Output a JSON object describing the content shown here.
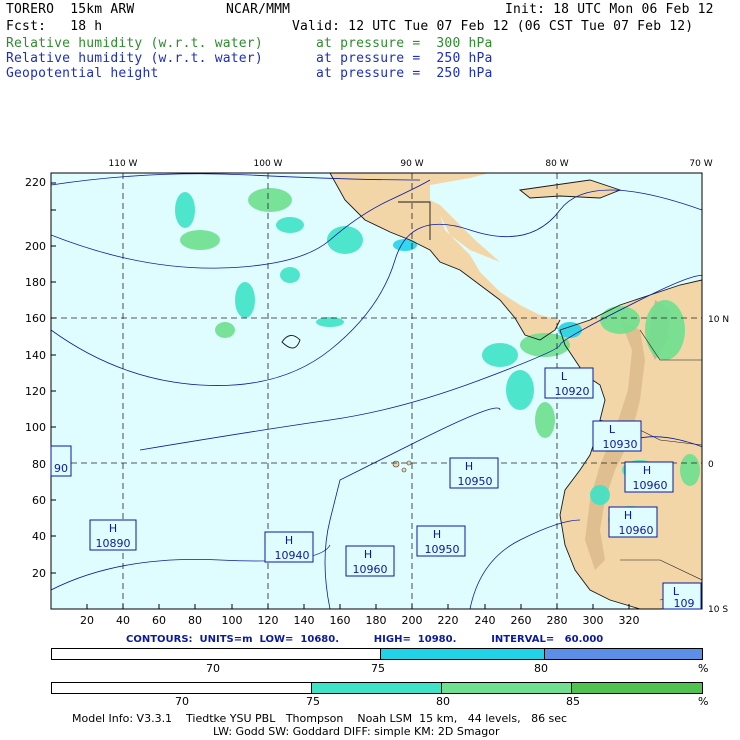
{
  "header": {
    "model": "TORERO  15km ARW",
    "center": "NCAR/MMM",
    "init": "Init: 18 UTC Mon 06 Feb 12",
    "fcst": "Fcst:   18 h",
    "valid": "Valid: 12 UTC Tue 07 Feb 12 (06 CST Tue 07 Feb 12)",
    "fields": [
      {
        "name": "Relative humidity (w.r.t. water)",
        "level": "at pressure =  300 hPa",
        "color": "#2e8b2e"
      },
      {
        "name": "Relative humidity (w.r.t. water)",
        "level": "at pressure =  250 hPa",
        "color": "#1c2fbf"
      },
      {
        "name": "Geopotential height",
        "level": "at pressure =  250 hPa",
        "color": "#1c2fbf"
      }
    ]
  },
  "map": {
    "lon_labels": [
      "110 W",
      "100 W",
      "90 W",
      "80 W",
      "70 W"
    ],
    "lat_labels": [
      "10 N",
      "0",
      "10 S"
    ],
    "x_ticks": [
      "20",
      "40",
      "60",
      "80",
      "100",
      "120",
      "140",
      "160",
      "180",
      "200",
      "220",
      "240",
      "260",
      "280",
      "300",
      "320"
    ],
    "y_ticks": [
      "20",
      "40",
      "60",
      "80",
      "100",
      "120",
      "140",
      "160",
      "180",
      "200",
      "220"
    ],
    "highs_lows": [
      {
        "type": "H",
        "value": "10890"
      },
      {
        "type": "H",
        "value": "10940"
      },
      {
        "type": "H",
        "value": "10960"
      },
      {
        "type": "H",
        "value": "10950"
      },
      {
        "type": "H",
        "value": "10950"
      },
      {
        "type": "L",
        "value": "10920"
      },
      {
        "type": "L",
        "value": "10930"
      },
      {
        "type": "H",
        "value": "10960"
      },
      {
        "type": "H",
        "value": "10960"
      },
      {
        "type": "L",
        "value": "109"
      },
      {
        "type": "",
        "value": "90"
      }
    ]
  },
  "contours": "CONTOURS:  UNITS=m  LOW=  10680.          HIGH=  10980.          INTERVAL=   60.000",
  "colorbar_250": {
    "labels": [
      "70",
      "75",
      "80",
      "%"
    ],
    "colors": [
      "#ffffff",
      "#ffffff",
      "#22d3e8",
      "#5b8fe8"
    ]
  },
  "colorbar_300": {
    "labels": [
      "70",
      "75",
      "80",
      "85",
      "%"
    ],
    "colors": [
      "#ffffff",
      "#ffffff",
      "#3fe3c8",
      "#6fe08f",
      "#4fc24f"
    ]
  },
  "footer": {
    "line1": "Model Info: V3.3.1    Tiedtke YSU PBL   Thompson    Noah LSM  15 km,   44 levels,   86 sec",
    "line2": "LW: Godd SW: Goddard DIFF: simple KM: 2D Smagor"
  }
}
